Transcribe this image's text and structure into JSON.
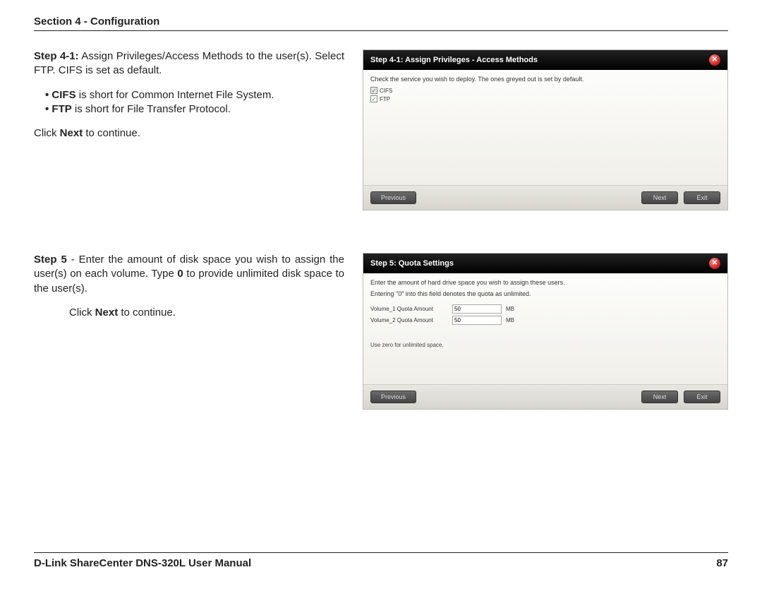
{
  "header": {
    "section_label": "Section 4 - Configuration"
  },
  "step41": {
    "lead_bold": "Step 4-1:",
    "lead_rest": " Assign Privileges/Access Methods to the user(s). Select FTP. CIFS is set as default.",
    "bullet1_bold": "CIFS",
    "bullet1_rest": " is short for Common Internet File System.",
    "bullet2_bold": "FTP",
    "bullet2_rest": " is short for File Transfer Protocol.",
    "click_pre": "Click ",
    "click_bold": "Next",
    "click_post": " to continue."
  },
  "step5": {
    "lead_bold": "Step 5",
    "lead_rest1": " - Enter the amount of disk space you wish to assign the user(s) on each volume. Type ",
    "zero_bold": "0",
    "lead_rest2": " to provide unlimited disk space to the user(s).",
    "click_pre": "Click ",
    "click_bold": "Next",
    "click_post": " to continue."
  },
  "dialog1": {
    "title": "Step 4-1: Assign Privileges - Access Methods",
    "hint": "Check the service you wish to deploy. The ones greyed out is set by default.",
    "opt_cifs": "CIFS",
    "opt_ftp": "FTP",
    "btn_prev": "Previous",
    "btn_next": "Next",
    "btn_exit": "Exit"
  },
  "dialog2": {
    "title": "Step 5: Quota Settings",
    "hint1": "Enter the amount of hard drive space you wish to assign these users.",
    "hint2": "Entering \"0\" into this field denotes the quota as unlimited.",
    "vol1_label": "Volume_1 Quota Amount",
    "vol2_label": "Volume_2 Quota Amount",
    "vol1_value": "50",
    "vol2_value": "50",
    "unit": "MB",
    "footnote": "Use zero for unlimited space.",
    "btn_prev": "Previous",
    "btn_next": "Next",
    "btn_exit": "Exit"
  },
  "footer": {
    "left": "D-Link ShareCenter DNS-320L User Manual",
    "right": "87"
  }
}
